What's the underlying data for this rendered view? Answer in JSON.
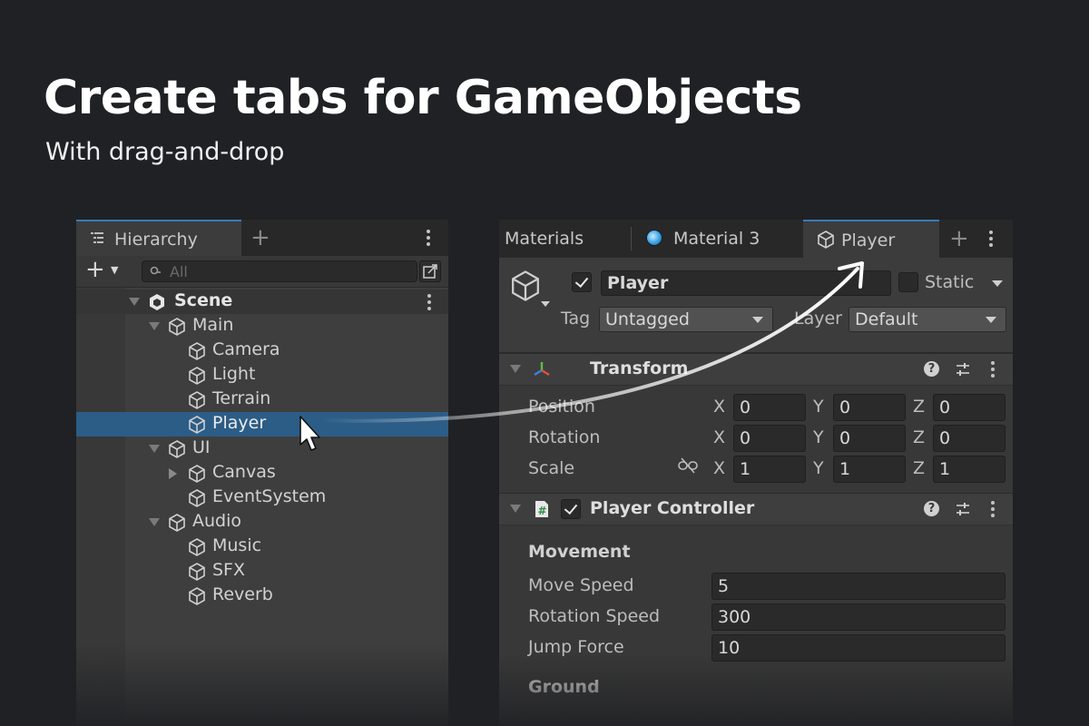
{
  "promo": {
    "headline": "Create tabs for GameObjects",
    "subline": "With drag-and-drop"
  },
  "hierarchy": {
    "tab_label": "Hierarchy",
    "search_placeholder": "All",
    "scene_label": "Scene",
    "items": [
      {
        "label": "Main",
        "depth": 1,
        "expander": "expanded"
      },
      {
        "label": "Camera",
        "depth": 2,
        "expander": "none"
      },
      {
        "label": "Light",
        "depth": 2,
        "expander": "none"
      },
      {
        "label": "Terrain",
        "depth": 2,
        "expander": "none"
      },
      {
        "label": "Player",
        "depth": 2,
        "expander": "none",
        "selected": true
      },
      {
        "label": "UI",
        "depth": 1,
        "expander": "expanded"
      },
      {
        "label": "Canvas",
        "depth": 2,
        "expander": "collapsed"
      },
      {
        "label": "EventSystem",
        "depth": 2,
        "expander": "none"
      },
      {
        "label": "Audio",
        "depth": 1,
        "expander": "expanded"
      },
      {
        "label": "Music",
        "depth": 2,
        "expander": "none"
      },
      {
        "label": "SFX",
        "depth": 2,
        "expander": "none"
      },
      {
        "label": "Reverb",
        "depth": 2,
        "expander": "none"
      }
    ]
  },
  "inspector": {
    "tabs": [
      {
        "label": "Materials",
        "icon": "none"
      },
      {
        "label": "Material 3",
        "icon": "material-sphere-icon"
      },
      {
        "label": "Player",
        "icon": "gameobject-cube-icon",
        "active": true
      }
    ],
    "gameobject": {
      "name": "Player",
      "active": true,
      "static_label": "Static",
      "static": false,
      "tag_label": "Tag",
      "tag_value": "Untagged",
      "layer_label": "Layer",
      "layer_value": "Default"
    },
    "transform": {
      "title": "Transform",
      "rows": [
        {
          "label": "Position",
          "x": "0",
          "y": "0",
          "z": "0"
        },
        {
          "label": "Rotation",
          "x": "0",
          "y": "0",
          "z": "0"
        },
        {
          "label": "Scale",
          "x": "1",
          "y": "1",
          "z": "1"
        }
      ],
      "axis_x": "X",
      "axis_y": "Y",
      "axis_z": "Z"
    },
    "player_controller": {
      "title": "Player Controller",
      "enabled": true,
      "section_movement": "Movement",
      "fields": [
        {
          "label": "Move Speed",
          "value": "5"
        },
        {
          "label": "Rotation Speed",
          "value": "300"
        },
        {
          "label": "Jump Force",
          "value": "10"
        }
      ],
      "section_ground": "Ground"
    }
  },
  "colors": {
    "background": "#202124",
    "selection": "#2c5d87",
    "tab_accent": "#3a79bb"
  }
}
